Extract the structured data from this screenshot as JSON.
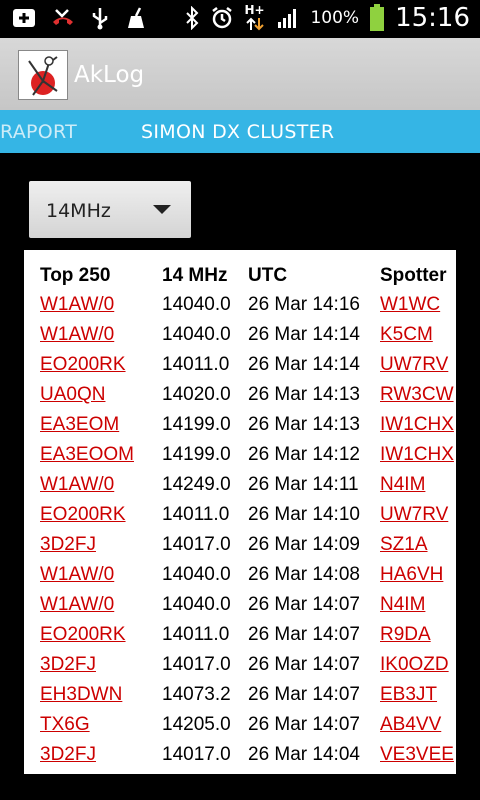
{
  "status_bar": {
    "time": "15:16",
    "battery_percent": "100%",
    "network_label": "H+",
    "icons": [
      "add-icon",
      "missed-call-icon",
      "usb-icon",
      "cleaner-icon",
      "bluetooth-icon",
      "alarm-icon",
      "data-arrows-icon",
      "signal-icon",
      "battery-icon"
    ]
  },
  "app": {
    "title": "AkLog"
  },
  "tabs": [
    {
      "label": "RAPORT"
    },
    {
      "label": "SIMON DX CLUSTER"
    }
  ],
  "band_selector": {
    "value": "14MHz"
  },
  "table": {
    "headers": [
      "Top 250",
      "14 MHz",
      "UTC",
      "Spotter"
    ],
    "rows": [
      [
        "W1AW/0",
        "14040.0",
        "26 Mar 14:16",
        "W1WC"
      ],
      [
        "W1AW/0",
        "14040.0",
        "26 Mar 14:14",
        "K5CM"
      ],
      [
        "EO200RK",
        "14011.0",
        "26 Mar 14:14",
        "UW7RV"
      ],
      [
        "UA0QN",
        "14020.0",
        "26 Mar 14:13",
        "RW3CW"
      ],
      [
        "EA3EOM",
        "14199.0",
        "26 Mar 14:13",
        "IW1CHX"
      ],
      [
        "EA3EOOM",
        "14199.0",
        "26 Mar 14:12",
        "IW1CHX"
      ],
      [
        "W1AW/0",
        "14249.0",
        "26 Mar 14:11",
        "N4IM"
      ],
      [
        "EO200RK",
        "14011.0",
        "26 Mar 14:10",
        "UW7RV"
      ],
      [
        "3D2FJ",
        "14017.0",
        "26 Mar 14:09",
        "SZ1A"
      ],
      [
        "W1AW/0",
        "14040.0",
        "26 Mar 14:08",
        "HA6VH"
      ],
      [
        "W1AW/0",
        "14040.0",
        "26 Mar 14:07",
        "N4IM"
      ],
      [
        "EO200RK",
        "14011.0",
        "26 Mar 14:07",
        "R9DA"
      ],
      [
        "3D2FJ",
        "14017.0",
        "26 Mar 14:07",
        "IK0OZD"
      ],
      [
        "EH3DWN",
        "14073.2",
        "26 Mar 14:07",
        "EB3JT"
      ],
      [
        "TX6G",
        "14205.0",
        "26 Mar 14:07",
        "AB4VV"
      ],
      [
        "3D2FJ",
        "14017.0",
        "26 Mar 14:04",
        "VE3VEE"
      ]
    ]
  },
  "colors": {
    "tab_bar": "#35b5e5",
    "link": "#cc0000",
    "battery": "#8fd13f"
  }
}
